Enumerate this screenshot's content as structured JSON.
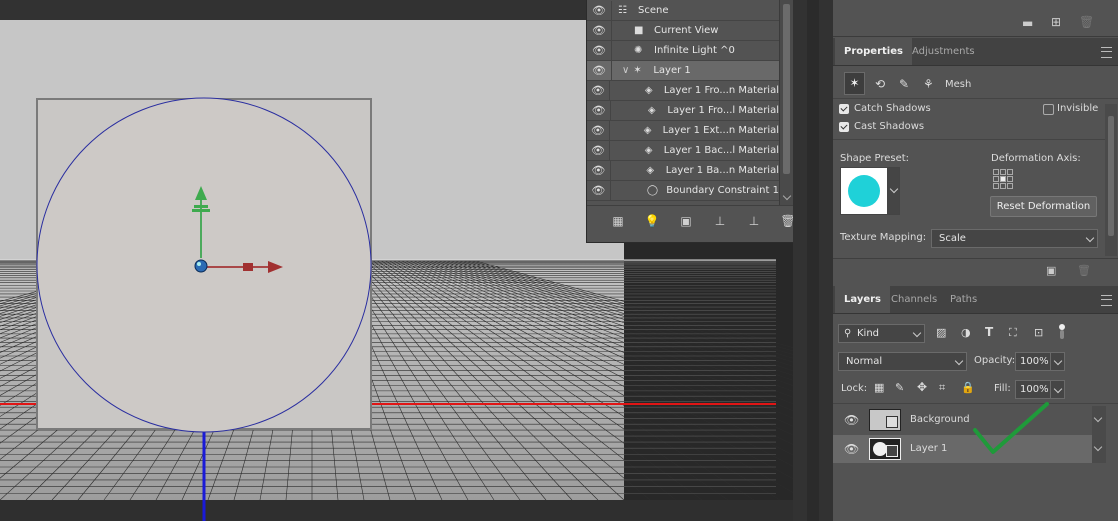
{
  "scene_panel": {
    "items": [
      {
        "label": "Scene",
        "icon": "scene-icon"
      },
      {
        "label": "Current View",
        "icon": "camera-icon"
      },
      {
        "label": "Infinite Light ^0",
        "icon": "light-icon"
      },
      {
        "label": "Layer 1",
        "icon": "mesh-icon",
        "expanded": true,
        "selected": true
      },
      {
        "label": "Layer 1 Fro...n Material",
        "icon": "material-icon"
      },
      {
        "label": "Layer 1 Fro...l Material",
        "icon": "material-icon"
      },
      {
        "label": "Layer 1 Ext...n Material",
        "icon": "material-icon"
      },
      {
        "label": "Layer 1 Bac...l Material",
        "icon": "material-icon"
      },
      {
        "label": "Layer 1 Ba...n Material",
        "icon": "material-icon"
      },
      {
        "label": "Boundary Constraint 1",
        "icon": "constraint-icon"
      }
    ],
    "toolbar_icons": [
      "filter-scene-icon",
      "add-light-icon",
      "render-icon",
      "drop-to-plane-icon",
      "delete-hidden-icon",
      "delete-icon"
    ]
  },
  "properties": {
    "tabs": [
      "Properties",
      "Adjustments"
    ],
    "active_tab": "Properties",
    "mode_label": "Mesh",
    "catch_shadows_label": "Catch Shadows",
    "catch_shadows_checked": true,
    "invisible_label": "Invisible",
    "invisible_checked": false,
    "cast_shadows_label": "Cast Shadows",
    "cast_shadows_checked": true,
    "shape_preset_label": "Shape Preset:",
    "shape_preset_color": "#1fd1d8",
    "deformation_axis_label": "Deformation Axis:",
    "reset_button_label": "Reset Deformation",
    "texture_mapping_label": "Texture Mapping:",
    "texture_mapping_value": "Scale"
  },
  "layers": {
    "tabs": [
      "Layers",
      "Channels",
      "Paths"
    ],
    "active_tab": "Layers",
    "filter_kind": "Kind",
    "blend_mode": "Normal",
    "opacity_label": "Opacity:",
    "opacity_value": "100%",
    "lock_label": "Lock:",
    "fill_label": "Fill:",
    "fill_value": "100%",
    "items": [
      {
        "name": "Background",
        "selected": false
      },
      {
        "name": "Layer 1",
        "selected": true
      }
    ]
  },
  "colors": {
    "x_axis": "#d21e1e",
    "y_axis": "#2fa84a",
    "z_axis": "#1a22d8",
    "checkmark": "#1f9a3a",
    "selection": "#696969"
  }
}
